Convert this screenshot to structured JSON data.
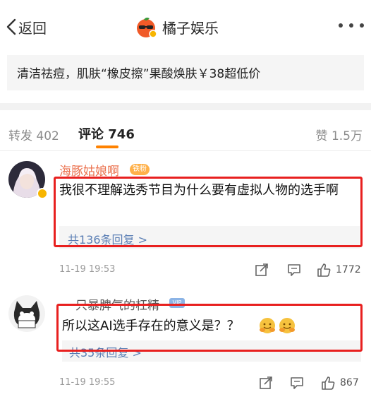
{
  "nav": {
    "back_label": "返回",
    "title": "橘子娱乐"
  },
  "promo": {
    "text": "清洁祛痘，肌肤“橡皮擦”果酸焕肤￥38超低价"
  },
  "tabs": {
    "repost": "转发 402",
    "comments": "评论 746",
    "likes": "赞 1.5万"
  },
  "comments": [
    {
      "username": "海豚姑娘啊",
      "fan_badge": "铁粉",
      "text": "我很不理解选秀节目为什么要有虚拟人物的选手啊",
      "reply_link": "共136条回复 >",
      "time": "11-19 19:53",
      "likes": "1772"
    },
    {
      "username": "一只暴脾气的杠精",
      "vip_badge": "VIP",
      "text": "所以这AI选手存在的意义是？？",
      "reply_link": "共35条回复 >",
      "time": "11-19 19:55",
      "likes": "867"
    }
  ],
  "colors": {
    "accent_orange": "#ff8200",
    "username_orange": "#eb7350",
    "link_blue": "#5a7eb4",
    "highlight_red": "#e8201f"
  },
  "icons": [
    "chevron-left-icon",
    "orange-logo-icon",
    "more-dots-icon",
    "share-icon",
    "comment-icon",
    "thumbs-up-icon",
    "verified-badge-icon",
    "fan-badge-icon",
    "vip-badge-icon",
    "hug-emoji-icon"
  ]
}
